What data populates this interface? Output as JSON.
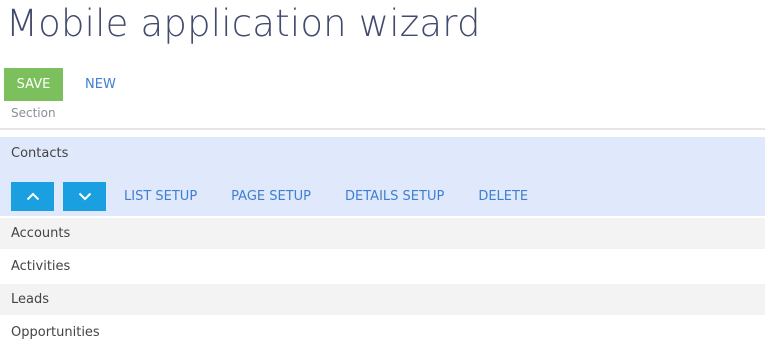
{
  "page_title": "Mobile application wizard",
  "toolbar": {
    "save_label": "SAVE",
    "new_label": "NEW"
  },
  "table": {
    "column_header": "Section",
    "selected_row": {
      "label": "Contacts",
      "actions": {
        "move_up_icon": "chevron-up-icon",
        "move_down_icon": "chevron-down-icon",
        "list_setup": "LIST SETUP",
        "page_setup": "PAGE SETUP",
        "details_setup": "DETAILS SETUP",
        "delete": "DELETE"
      }
    },
    "rows": [
      "Accounts",
      "Activities",
      "Leads",
      "Opportunities"
    ]
  },
  "colors": {
    "save_button": "#7cc05e",
    "link": "#3e7fd1",
    "arrow_button": "#1aa0e0",
    "selected_row_bg": "#dfe9fb"
  }
}
